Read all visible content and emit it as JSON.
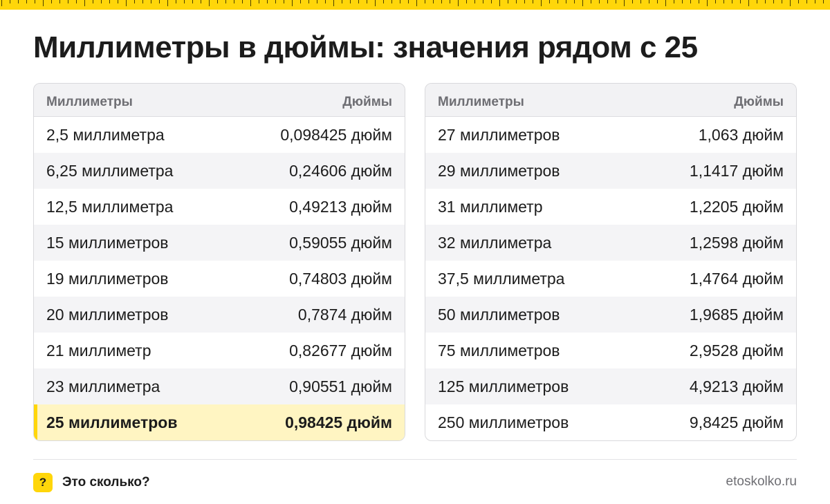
{
  "title": "Миллиметры в дюймы: значения рядом с 25",
  "headers": {
    "mm": "Миллиметры",
    "in": "Дюймы"
  },
  "left_rows": [
    {
      "mm": "2,5 миллиметра",
      "in": "0,098425 дюйм"
    },
    {
      "mm": "6,25 миллиметра",
      "in": "0,24606 дюйм"
    },
    {
      "mm": "12,5 миллиметра",
      "in": "0,49213 дюйм"
    },
    {
      "mm": "15 миллиметров",
      "in": "0,59055 дюйм"
    },
    {
      "mm": "19 миллиметров",
      "in": "0,74803 дюйм"
    },
    {
      "mm": "20 миллиметров",
      "in": "0,7874 дюйм"
    },
    {
      "mm": "21 миллиметр",
      "in": "0,82677 дюйм"
    },
    {
      "mm": "23 миллиметра",
      "in": "0,90551 дюйм"
    },
    {
      "mm": "25 миллиметров",
      "in": "0,98425 дюйм"
    }
  ],
  "right_rows": [
    {
      "mm": "27 миллиметров",
      "in": "1,063 дюйм"
    },
    {
      "mm": "29 миллиметров",
      "in": "1,1417 дюйм"
    },
    {
      "mm": "31 миллиметр",
      "in": "1,2205 дюйм"
    },
    {
      "mm": "32 миллиметра",
      "in": "1,2598 дюйм"
    },
    {
      "mm": "37,5 миллиметра",
      "in": "1,4764 дюйм"
    },
    {
      "mm": "50 миллиметров",
      "in": "1,9685 дюйм"
    },
    {
      "mm": "75 миллиметров",
      "in": "2,9528 дюйм"
    },
    {
      "mm": "125 миллиметров",
      "in": "4,9213 дюйм"
    },
    {
      "mm": "250 миллиметров",
      "in": "9,8425 дюйм"
    }
  ],
  "footer": {
    "icon_glyph": "?",
    "brand": "Это сколько?",
    "site": "etoskolko.ru"
  },
  "colors": {
    "accent": "#ffd60a",
    "highlight_row": "#fff5c2"
  }
}
